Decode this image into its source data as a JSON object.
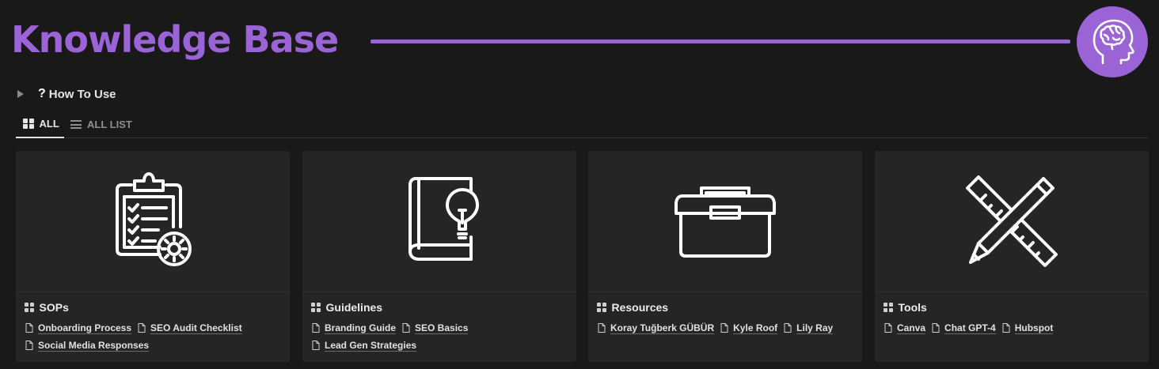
{
  "header": {
    "title": "Knowledge Base",
    "accent_color": "#9b64d6",
    "avatar_icon": "brain-head-icon"
  },
  "toggle": {
    "icon": "question-icon",
    "glyph": "?",
    "label": "How To Use"
  },
  "tabs": [
    {
      "label": "ALL",
      "icon": "gallery-icon",
      "active": true
    },
    {
      "label": "ALL LIST",
      "icon": "list-icon",
      "active": false
    }
  ],
  "cards": [
    {
      "title": "SOPs",
      "cover_icon": "clipboard-checklist-icon",
      "links": [
        "Onboarding Process",
        "SEO Audit Checklist",
        "Social Media Responses"
      ]
    },
    {
      "title": "Guidelines",
      "cover_icon": "book-lightbulb-icon",
      "links": [
        "Branding Guide",
        "SEO Basics",
        "Lead Gen Strategies"
      ]
    },
    {
      "title": "Resources",
      "cover_icon": "toolbox-icon",
      "links": [
        "Koray Tuğberk GÜBÜR",
        "Kyle Roof",
        "Lily Ray"
      ]
    },
    {
      "title": "Tools",
      "cover_icon": "ruler-pencil-icon",
      "links": [
        "Canva",
        "Chat GPT-4",
        "Hubspot"
      ]
    }
  ]
}
